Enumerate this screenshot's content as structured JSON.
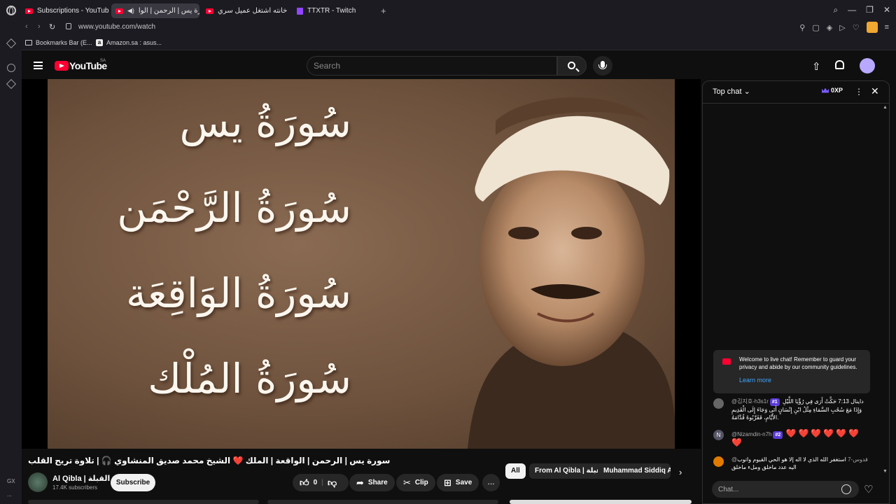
{
  "browser": {
    "tabs": [
      {
        "label": "Subscriptions - YouTube",
        "type": "youtube",
        "active": false
      },
      {
        "label": "سورة يس | الرحمن | الوا",
        "type": "youtube",
        "active": true
      },
      {
        "label": "بعد ما خانته اشتغل عميل سري",
        "type": "youtube",
        "active": false
      },
      {
        "label": "TTXTR - Twitch",
        "type": "twitch",
        "active": false
      }
    ],
    "new_tab": "+",
    "url": "www.youtube.com/watch",
    "bookmarks": [
      {
        "label": "Bookmarks Bar (E...",
        "icon": "folder-icon"
      },
      {
        "label": "Amazon.sa : asus...",
        "icon": "amazon-icon"
      }
    ],
    "sidebar_bottom": [
      "GX",
      "..."
    ]
  },
  "youtube": {
    "logo_text": "YouTube",
    "country": "SA",
    "search_placeholder": "Search"
  },
  "video": {
    "calligraphy": [
      "سُورَةُ يس",
      "سُورَةُ الرَّحْمَن",
      "سُورَةُ الوَاقِعَة",
      "سُورَةُ المُلْك"
    ],
    "title": "سورة يس | الرحمن | الواقعة | الملك ❤️ الشيخ محمد صديق المنشاوي 🎧 | تلاوة تريح القلب",
    "channel_name": "Al Qibla | القبلة",
    "subscribers": "17.4K subscribers",
    "subscribe_label": "Subscribe",
    "like_count": "0",
    "share_label": "Share",
    "clip_label": "Clip",
    "save_label": "Save",
    "more_label": "..."
  },
  "chips": [
    {
      "label": "All",
      "selected": true
    },
    {
      "label": "From Al Qibla | القبلة",
      "selected": false
    },
    {
      "label": "Muhammad Siddiq Al",
      "selected": false
    }
  ],
  "chat": {
    "title": "Top chat",
    "xp": "0XP",
    "welcome_text": "Welcome to live chat! Remember to guard your privacy and abide by our community guidelines.",
    "learn_more": "Learn more",
    "messages": [
      {
        "author": "@김지호-h3s1r",
        "rank": "#1",
        "text": "داينال 7:13 حَكَّتْ أَرَى فِي رُؤْيَا اللَّيْلِ وَإِذَا مَعَ سُحُبِ السَّمَاءِ مِثْلُ ابْنِ إِنْسَانٍ أَتَى وَجَاءَ إِلَى الْقَدِيمِ الأَيَّامِ، فَقَرَّبُوهُ قُدَّامَهُ."
      },
      {
        "author": "@Nizamdin-n7h",
        "rank": "#2",
        "text": "❤️❤️❤️❤️❤️❤️❤️"
      },
      {
        "author": "@قدوس-7",
        "rank": "",
        "text": "استغفر الله الذي لا اله إلا هو الحي القيوم واتوب اليه عدد ماخلق وملء ماخلق"
      }
    ],
    "input_placeholder": "Chat..."
  }
}
